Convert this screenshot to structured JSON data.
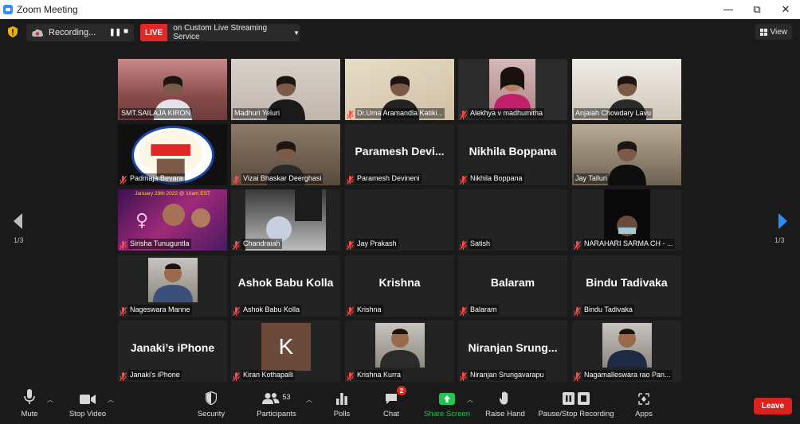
{
  "window": {
    "title": "Zoom Meeting",
    "minimize": "—",
    "restore": "⧉",
    "close": "✕"
  },
  "topbar": {
    "recording_label": "Recording...",
    "live_badge": "LIVE",
    "live_service": "on Custom Live Streaming Service",
    "view_label": "View"
  },
  "pagination": {
    "left": "1/3",
    "right": "1/3"
  },
  "participants": [
    {
      "label": "SMT.SAILAJA KIRON",
      "big": "",
      "muted": false,
      "kind": "video",
      "scene": "pink"
    },
    {
      "label": "Madhuri Yeluri",
      "big": "",
      "muted": false,
      "kind": "video",
      "scene": "woman"
    },
    {
      "label": "Dr.Uma Aramandla Katiki...",
      "big": "",
      "muted": true,
      "kind": "video",
      "scene": "map"
    },
    {
      "label": "Alekhya v madhumitha",
      "big": "",
      "muted": true,
      "kind": "video",
      "scene": "photo"
    },
    {
      "label": "Anjaiah Chowdary Lavu",
      "big": "",
      "muted": false,
      "kind": "video",
      "scene": "office"
    },
    {
      "label": "Padmaja Bevara",
      "big": "",
      "muted": true,
      "kind": "video",
      "scene": "logo"
    },
    {
      "label": "Vizai Bhaskar Deerghasi",
      "big": "",
      "muted": true,
      "kind": "video",
      "scene": "books"
    },
    {
      "label": "Paramesh Devineni",
      "big": "Paramesh  Devi...",
      "muted": true,
      "kind": "name"
    },
    {
      "label": "Nikhila Boppana",
      "big": "Nikhila Boppana",
      "muted": true,
      "kind": "name"
    },
    {
      "label": "Jay Talluri",
      "big": "",
      "muted": false,
      "kind": "video",
      "scene": "man",
      "speaking": true
    },
    {
      "label": "Sirisha Tunuguntla",
      "big": "",
      "muted": true,
      "kind": "video",
      "scene": "poster",
      "poster_text": "January 29th 2022 @ 10am EST"
    },
    {
      "label": "Chandraiah",
      "big": "",
      "muted": true,
      "kind": "video",
      "scene": "room"
    },
    {
      "label": "Jay Prakash",
      "big": "",
      "muted": true,
      "kind": "blank"
    },
    {
      "label": "Satish",
      "big": "",
      "muted": true,
      "kind": "blank"
    },
    {
      "label": "NARAHARI SARMA CH - ...",
      "big": "",
      "muted": true,
      "kind": "video",
      "scene": "dark"
    },
    {
      "label": "Nageswara Manne",
      "big": "",
      "muted": true,
      "kind": "video",
      "scene": "avatar"
    },
    {
      "label": "Ashok Babu Kolla",
      "big": "Ashok Babu Kolla",
      "muted": true,
      "kind": "name"
    },
    {
      "label": "Krishna",
      "big": "Krishna",
      "muted": true,
      "kind": "name"
    },
    {
      "label": "Balaram",
      "big": "Balaram",
      "muted": true,
      "kind": "name"
    },
    {
      "label": "Bindu Tadivaka",
      "big": "Bindu Tadivaka",
      "muted": true,
      "kind": "name"
    },
    {
      "label": "Janaki's iPhone",
      "big": "Janaki’s iPhone",
      "muted": true,
      "kind": "name"
    },
    {
      "label": "Kiran Kothapalli",
      "big": "",
      "muted": true,
      "kind": "letter",
      "letter": "K"
    },
    {
      "label": "Krishna Kurra",
      "big": "",
      "muted": true,
      "kind": "video",
      "scene": "portrait"
    },
    {
      "label": "Niranjan Srungavarapu",
      "big": "Niranjan  Srung...",
      "muted": true,
      "kind": "name"
    },
    {
      "label": "Nagamalleswara rao Pan...",
      "big": "",
      "muted": true,
      "kind": "video",
      "scene": "suit"
    }
  ],
  "toolbar": {
    "mute": "Mute",
    "stop_video": "Stop Video",
    "security": "Security",
    "participants": "Participants",
    "participants_count": "53",
    "polls": "Polls",
    "chat": "Chat",
    "chat_badge": "2",
    "share_screen": "Share Screen",
    "raise_hand": "Raise Hand",
    "pause_stop_recording": "Pause/Stop Recording",
    "apps": "Apps",
    "leave": "Leave"
  },
  "colors": {
    "background": "#1a1a1a",
    "tile": "#232323",
    "live_red": "#e02828",
    "leave_red": "#d9231f",
    "share_green": "#23c552",
    "speaking_outline": "#c9d93a",
    "accent_blue": "#2d8cff"
  }
}
